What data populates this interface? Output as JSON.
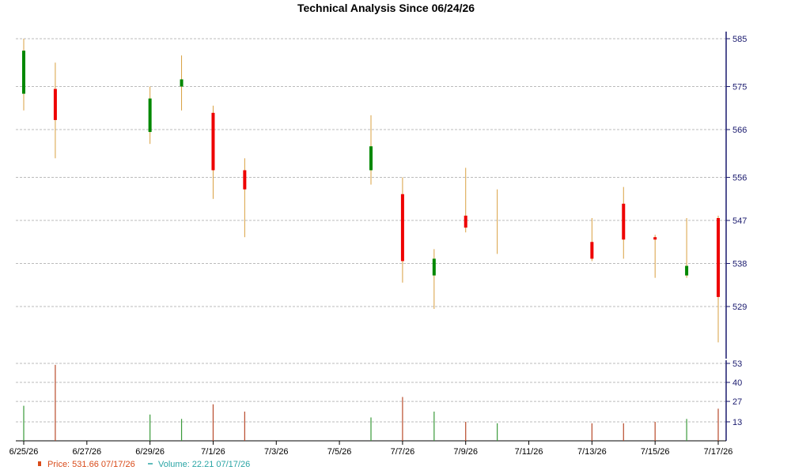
{
  "chart_data": {
    "type": "candlestick",
    "title": "Technical Analysis Since 06/24/26",
    "price_axis": {
      "ylim": [
        522,
        586
      ],
      "ticks": [
        585,
        575,
        566,
        556,
        547,
        538,
        529
      ]
    },
    "volume_axis": {
      "ylim": [
        0,
        53
      ],
      "ticks": [
        53,
        40,
        27,
        13
      ]
    },
    "x_tick_labels": [
      "6/25/26",
      "6/27/26",
      "6/29/26",
      "7/1/26",
      "7/3/26",
      "7/5/26",
      "7/7/26",
      "7/9/26",
      "7/11/26",
      "7/13/26",
      "7/15/26",
      "7/17/26"
    ],
    "x_tick_dates": [
      "2026-06-25",
      "2026-06-27",
      "2026-06-29",
      "2026-07-01",
      "2026-07-03",
      "2026-07-05",
      "2026-07-07",
      "2026-07-09",
      "2026-07-11",
      "2026-07-13",
      "2026-07-15",
      "2026-07-17"
    ],
    "grid": true,
    "candles": [
      {
        "date": "2026-06-25",
        "open": 573.5,
        "close": 582.5,
        "high": 585.0,
        "low": 570.0,
        "volume": 24,
        "direction": "up"
      },
      {
        "date": "2026-06-26",
        "open": 574.5,
        "close": 568.0,
        "high": 580.0,
        "low": 560.0,
        "volume": 52,
        "direction": "down"
      },
      {
        "date": "2026-06-29",
        "open": 565.5,
        "close": 572.5,
        "high": 575.0,
        "low": 563.0,
        "volume": 18,
        "direction": "up"
      },
      {
        "date": "2026-06-30",
        "open": 575.0,
        "close": 576.5,
        "high": 581.5,
        "low": 570.0,
        "volume": 15,
        "direction": "up"
      },
      {
        "date": "2026-07-01",
        "open": 569.5,
        "close": 557.5,
        "high": 571.0,
        "low": 551.5,
        "volume": 25,
        "direction": "down"
      },
      {
        "date": "2026-07-02",
        "open": 557.5,
        "close": 553.5,
        "high": 560.0,
        "low": 543.5,
        "volume": 20,
        "direction": "down"
      },
      {
        "date": "2026-07-06",
        "open": 557.5,
        "close": 562.5,
        "high": 569.0,
        "low": 554.5,
        "volume": 16,
        "direction": "up"
      },
      {
        "date": "2026-07-07",
        "open": 552.5,
        "close": 538.5,
        "high": 556.0,
        "low": 534.0,
        "volume": 30,
        "direction": "down"
      },
      {
        "date": "2026-07-08",
        "open": 535.5,
        "close": 539.0,
        "high": 541.0,
        "low": 528.5,
        "volume": 20,
        "direction": "up"
      },
      {
        "date": "2026-07-09",
        "open": 548.0,
        "close": 545.5,
        "high": 558.0,
        "low": 544.5,
        "volume": 13,
        "direction": "down"
      },
      {
        "date": "2026-07-10",
        "open": 547.0,
        "close": 547.0,
        "high": 553.5,
        "low": 540.0,
        "volume": 12,
        "direction": "flat"
      },
      {
        "date": "2026-07-13",
        "open": 542.5,
        "close": 539.0,
        "high": 547.5,
        "low": 538.5,
        "volume": 12,
        "direction": "down"
      },
      {
        "date": "2026-07-14",
        "open": 550.5,
        "close": 543.0,
        "high": 554.0,
        "low": 539.0,
        "volume": 12,
        "direction": "down"
      },
      {
        "date": "2026-07-15",
        "open": 543.5,
        "close": 543.0,
        "high": 544.0,
        "low": 535.0,
        "volume": 13,
        "direction": "down"
      },
      {
        "date": "2026-07-16",
        "open": 535.5,
        "close": 537.5,
        "high": 547.5,
        "low": 535.0,
        "volume": 15,
        "direction": "up"
      },
      {
        "date": "2026-07-17",
        "open": 547.5,
        "close": 531.0,
        "high": 548.0,
        "low": 521.5,
        "volume": 22,
        "direction": "down"
      }
    ],
    "legend": [
      {
        "label": "Price: 531.66  07/17/26",
        "color": "#d94b1a",
        "marker": "square"
      },
      {
        "label": "Volume: 22.21  07/17/26",
        "color": "#2aa5a5",
        "marker": "dash"
      }
    ],
    "colors": {
      "up": "#008800",
      "down": "#ee0000",
      "wick": "#d9a040",
      "volume_up": "#3a9a3a",
      "volume_down": "#b84a2a",
      "volume_flat": "#3a9a3a",
      "grid": "#bbbbbb",
      "axis": "#1a1a6e"
    }
  }
}
